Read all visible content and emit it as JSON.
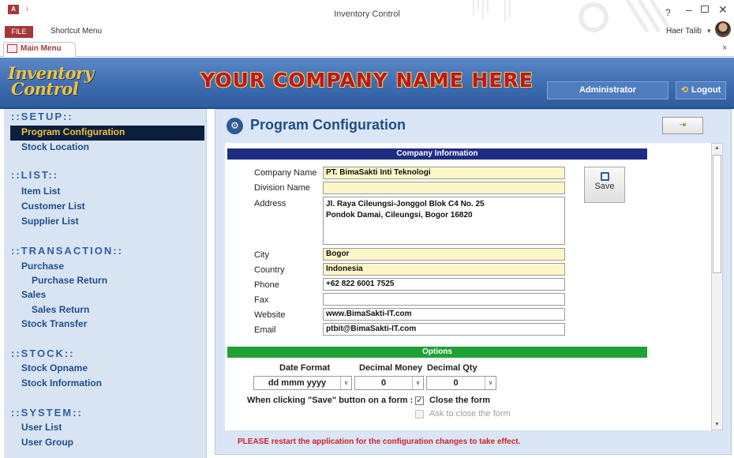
{
  "window": {
    "title": "Inventory Control",
    "app_icon": "A",
    "qat": "↓",
    "help": "?",
    "minimize": "–",
    "close": "✕",
    "file_tab": "FILE",
    "shortcut_menu": "Shortcut Menu",
    "user_name": "Haer Talib",
    "user_caret": "▾"
  },
  "doc_tabs": {
    "active": "Main Menu",
    "close": "×"
  },
  "header": {
    "logo_line1": "Inventory",
    "logo_line2": "Control",
    "company_name": "YOUR COMPANY NAME HERE",
    "role": "Administrator",
    "logout": "Logout",
    "logout_icon": "⟲"
  },
  "sidebar": {
    "sections": [
      {
        "label": "::SETUP::"
      },
      {
        "label": "::LIST::"
      },
      {
        "label": "::TRANSACTION::"
      },
      {
        "label": "::STOCK::"
      },
      {
        "label": "::SYSTEM::"
      }
    ],
    "items": [
      {
        "label": "Program Configuration"
      },
      {
        "label": "Stock Location"
      },
      {
        "label": "Item List"
      },
      {
        "label": "Customer List"
      },
      {
        "label": "Supplier List"
      },
      {
        "label": "Purchase"
      },
      {
        "label": "Purchase Return"
      },
      {
        "label": "Sales"
      },
      {
        "label": "Sales Return"
      },
      {
        "label": "Stock Transfer"
      },
      {
        "label": "Stock Opname"
      },
      {
        "label": "Stock Information"
      },
      {
        "label": "User List"
      },
      {
        "label": "User Group"
      }
    ]
  },
  "panel": {
    "title": "Program Configuration",
    "title_icon": "⚙",
    "exit_icon": "⇥"
  },
  "company": {
    "section_title": "Company Information",
    "labels": {
      "company_name": "Company Name",
      "division_name": "Division Name",
      "address": "Address",
      "city": "City",
      "country": "Country",
      "phone": "Phone",
      "fax": "Fax",
      "website": "Website",
      "email": "Email"
    },
    "values": {
      "company_name": "PT. BimaSakti Inti Teknologi",
      "division_name": "",
      "address_line1": "Jl. Raya Cileungsi-Jonggol Blok C4 No. 25",
      "address_line2": "Pondok Damai, Cileungsi, Bogor 16820",
      "city": "Bogor",
      "country": "Indonesia",
      "phone": "+62 822 6001 7525",
      "fax": "",
      "website": "www.BimaSakti-IT.com",
      "email": "ptbit@BimaSakti-IT.com"
    },
    "save_label": "Save"
  },
  "options": {
    "section_title": "Options",
    "date_format_label": "Date Format",
    "date_format_value": "dd mmm yyyy",
    "decimal_money_label": "Decimal Money",
    "decimal_money_value": "0",
    "decimal_qty_label": "Decimal Qty",
    "decimal_qty_value": "0",
    "dropdown_arrow": "∨",
    "save_prompt": "When clicking \"Save\" button on a form :",
    "close_form_label": "Close the form",
    "close_form_checked": "✓",
    "ask_close_label": "Ask to close the form"
  },
  "scroll": {
    "up": "▲",
    "down": "▼"
  },
  "notice": "PLEASE restart the application for the configuration changes to take effect."
}
